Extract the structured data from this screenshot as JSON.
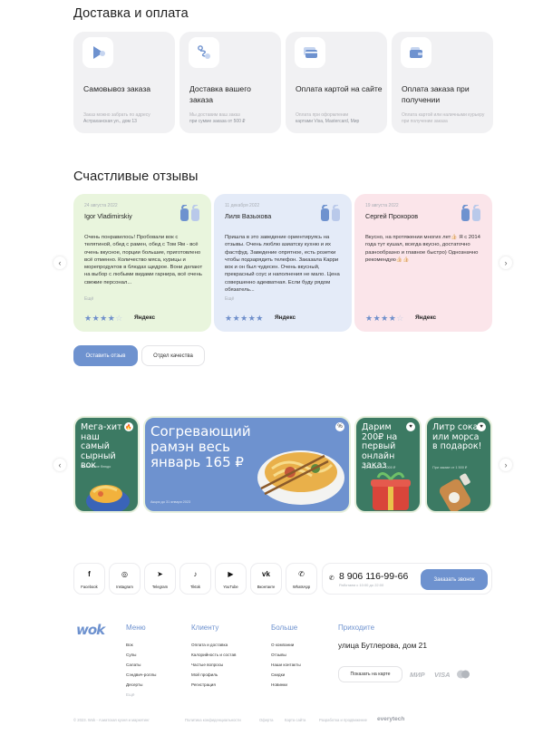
{
  "delivery": {
    "title": "Доставка и оплата",
    "cards": [
      {
        "icon": "location-arrow-icon",
        "title": "Самовывоз заказа",
        "sub_a": "Заказ можно забрать по адресу",
        "sub_b": "Астраханская ул., дом 13"
      },
      {
        "icon": "route-icon",
        "title": "Доставка вашего заказа",
        "sub_a": "Мы доставим ваш заказ",
        "sub_b": "при сумме заказа от 500 ₽"
      },
      {
        "icon": "credit-card-icon",
        "title": "Оплата картой на сайте",
        "sub_a": "Оплата при оформлении",
        "sub_b": "картами Visa, Mastercard, Мир"
      },
      {
        "icon": "wallet-icon",
        "title": "Оплата заказа при получении",
        "sub_a": "Оплата картой или наличными курьеру при получении заказа",
        "sub_b": ""
      }
    ]
  },
  "reviews": {
    "title": "Счастливые отзывы",
    "items": [
      {
        "date": "24 августа 2022",
        "name": "Igor Vladimirskiy",
        "text": "Очень понравилось! Пробовали вок с телятиной, обед с рамен, обед с Том Ям - всё очень вкусное, порции большие, приготовлено всё отменно. Количество мяса, курицы и морепродуктов в блюдах щедрое. Вони делают на выбор с любыми видами гарнира, всё очень свежие персонал...",
        "more": "Ещё",
        "rating": 4,
        "source": "Яндекс",
        "bg": "#e9f5dd"
      },
      {
        "date": "11 декабря 2022",
        "name": "Лиля Вазыхова",
        "text": "Пришла в это заведение ориентируясь на отзывы. Очень люблю азиатску кухню и их фастфуд. Заведение опрятное, есть розетки чтобы подзарядить телефон. Заказала Карри вок и он был чудесен. Очень вкусный, прекрасный соус и наполнения не мало. Цена совершенно адекватная. Если буду рядом обязатель...",
        "more": "Ещё",
        "rating": 5,
        "source": "Яндекс",
        "bg": "#e4ebf8"
      },
      {
        "date": "19 августа 2022",
        "name": "Сергей Прохоров",
        "text": "Вкусно, на протяжении многих лет👍🏻 Я с 2014 года тут кушал, всегда вкусно, достаточно разнообразно и главное быстро) Однозначно рекомендую👍🏻👍🏻",
        "more": "",
        "rating": 4,
        "source": "Яндекс",
        "bg": "#fbe5ea"
      }
    ],
    "buttons": {
      "leave": "Оставить отзыв",
      "quality": "Отдел качества"
    }
  },
  "promos": [
    {
      "title": "Мега-хит наш самый сырный вок",
      "date": "Уникальное блюдо",
      "badge": "fire-icon",
      "bg": "#3c7a63"
    },
    {
      "title": "Согревающий рамэн весь январь 165 ₽",
      "date": "Акция до 31 января 2023",
      "badge": "percent-icon",
      "bg": "#6e92cf"
    },
    {
      "title": "Дарим 200₽ на первый онлайн заказ",
      "date": "При заказе от 1000 ₽",
      "badge": "heart-icon",
      "bg": "#3c7a63"
    },
    {
      "title": "Литр сока или морса в подарок!",
      "date": "При заказе от 1 500 ₽",
      "badge": "heart-icon",
      "bg": "#3c7a63"
    }
  ],
  "socials": [
    {
      "label": "Facebook",
      "glyph": "f",
      "icon": "facebook-icon"
    },
    {
      "label": "Instagram",
      "glyph": "◎",
      "icon": "instagram-icon"
    },
    {
      "label": "Telegram",
      "glyph": "➤",
      "icon": "telegram-icon"
    },
    {
      "label": "Tiktok",
      "glyph": "♪",
      "icon": "tiktok-icon"
    },
    {
      "label": "YouTube",
      "glyph": "▶",
      "icon": "youtube-icon"
    },
    {
      "label": "Вконтакте",
      "glyph": "vk",
      "icon": "vk-icon"
    },
    {
      "label": "WhatsApp",
      "glyph": "✆",
      "icon": "whatsapp-icon"
    }
  ],
  "contact": {
    "phone": "8 906 116-99-66",
    "phone_sub": "Работаем с 10:00 до 22:00",
    "call_button": "Заказать звонок"
  },
  "footer": {
    "logo": "wok",
    "columns": [
      {
        "title": "Меню",
        "links": [
          "Вок",
          "Супы",
          "Салаты",
          "Сэндвич-роллы",
          "Десерты",
          "Ещё"
        ]
      },
      {
        "title": "Клиенту",
        "links": [
          "Оплата и доставка",
          "Калорийность и состав",
          "Частые вопросы",
          "Мой профиль",
          "Регистрация"
        ]
      },
      {
        "title": "Больше",
        "links": [
          "О компании",
          "Отзывы",
          "Наши контакты",
          "Скидки",
          "Новинки"
        ]
      }
    ],
    "contacts_title": "Приходите",
    "address": "улица Бутлерова, дом 21",
    "map_button": "Показать на карте",
    "payments": [
      "МИР",
      "VISA",
      "mastercard-icon"
    ],
    "bottom": [
      "© 2023. Wok - Азиатская кухня и маркетинг",
      "Политика конфиденциальности",
      "Оферта",
      "Карта сайта",
      "Разработка и продвижение",
      "everytech"
    ]
  }
}
